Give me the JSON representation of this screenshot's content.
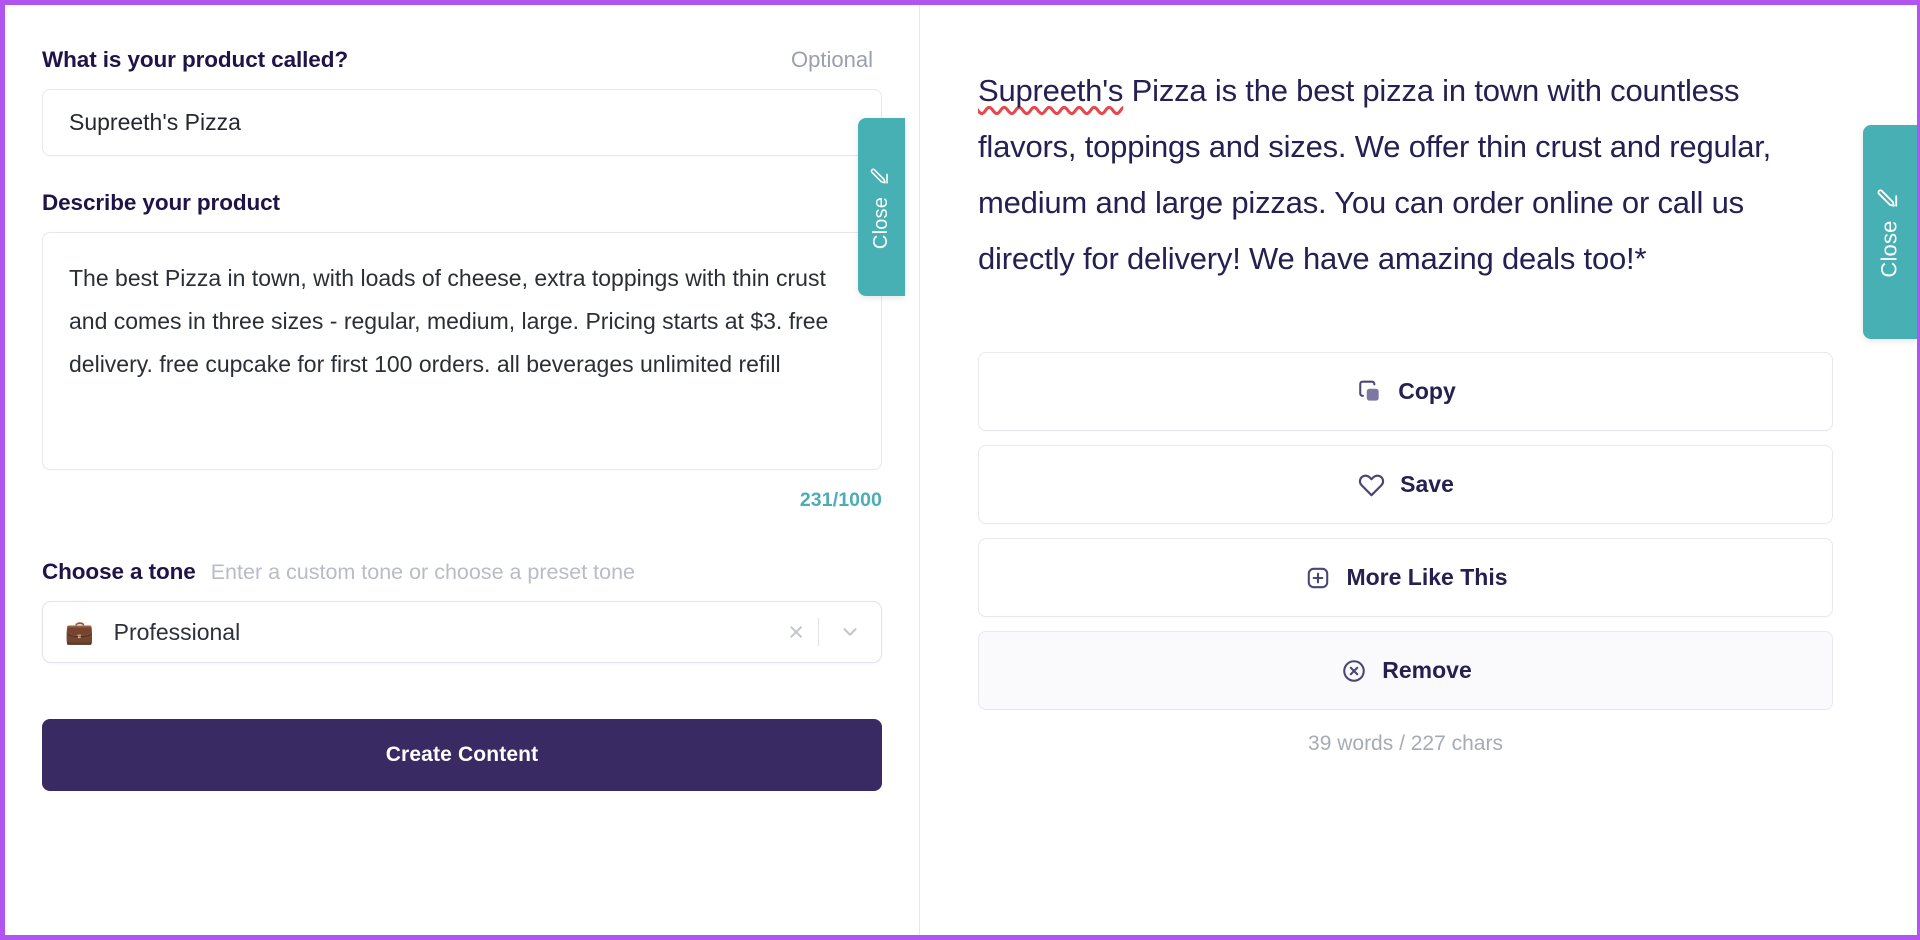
{
  "colors": {
    "frame_border": "#b254f0",
    "accent_teal": "#46b0b4",
    "cta_purple": "#3a2a63",
    "heading_purple": "#1f1347",
    "muted_grey": "#a7abb6"
  },
  "left_panel": {
    "product_name_field": {
      "label": "What is your product called?",
      "optional_tag": "Optional",
      "value": "Supreeth's Pizza",
      "placeholder": "What is your product called?"
    },
    "describe_field": {
      "label": "Describe your product",
      "value": "The best Pizza in town, with loads of cheese, extra toppings with thin crust and comes in three sizes - regular, medium, large. Pricing starts at $3. free delivery. free cupcake for first 100 orders. all beverages unlimited refill",
      "placeholder": "Describe your product",
      "counter": "231/1000"
    },
    "tone_field": {
      "label": "Choose a tone",
      "hint": "Enter a custom tone or choose a preset tone",
      "selected_emoji": "💼",
      "selected_value": "Professional",
      "clear_glyph": "×"
    },
    "cta_label": "Create Content",
    "close_tab": {
      "label": "Close",
      "icon": "pencil-icon"
    }
  },
  "right_panel": {
    "generated": {
      "misspelled_word": "Supreeth's",
      "rest": " Pizza is the best pizza in town with countless flavors, toppings and sizes. We offer thin crust and regular, medium and large pizzas. You can order online or call us directly for delivery! We have amazing deals too!*"
    },
    "actions": [
      {
        "label": "Copy",
        "icon": "copy-icon"
      },
      {
        "label": "Save",
        "icon": "heart-icon"
      },
      {
        "label": "More Like This",
        "icon": "plus-square-icon"
      },
      {
        "label": "Remove",
        "icon": "close-circle-icon"
      }
    ],
    "stats": "39 words / 227 chars",
    "close_tab": {
      "label": "Close",
      "icon": "pencil-icon"
    }
  }
}
